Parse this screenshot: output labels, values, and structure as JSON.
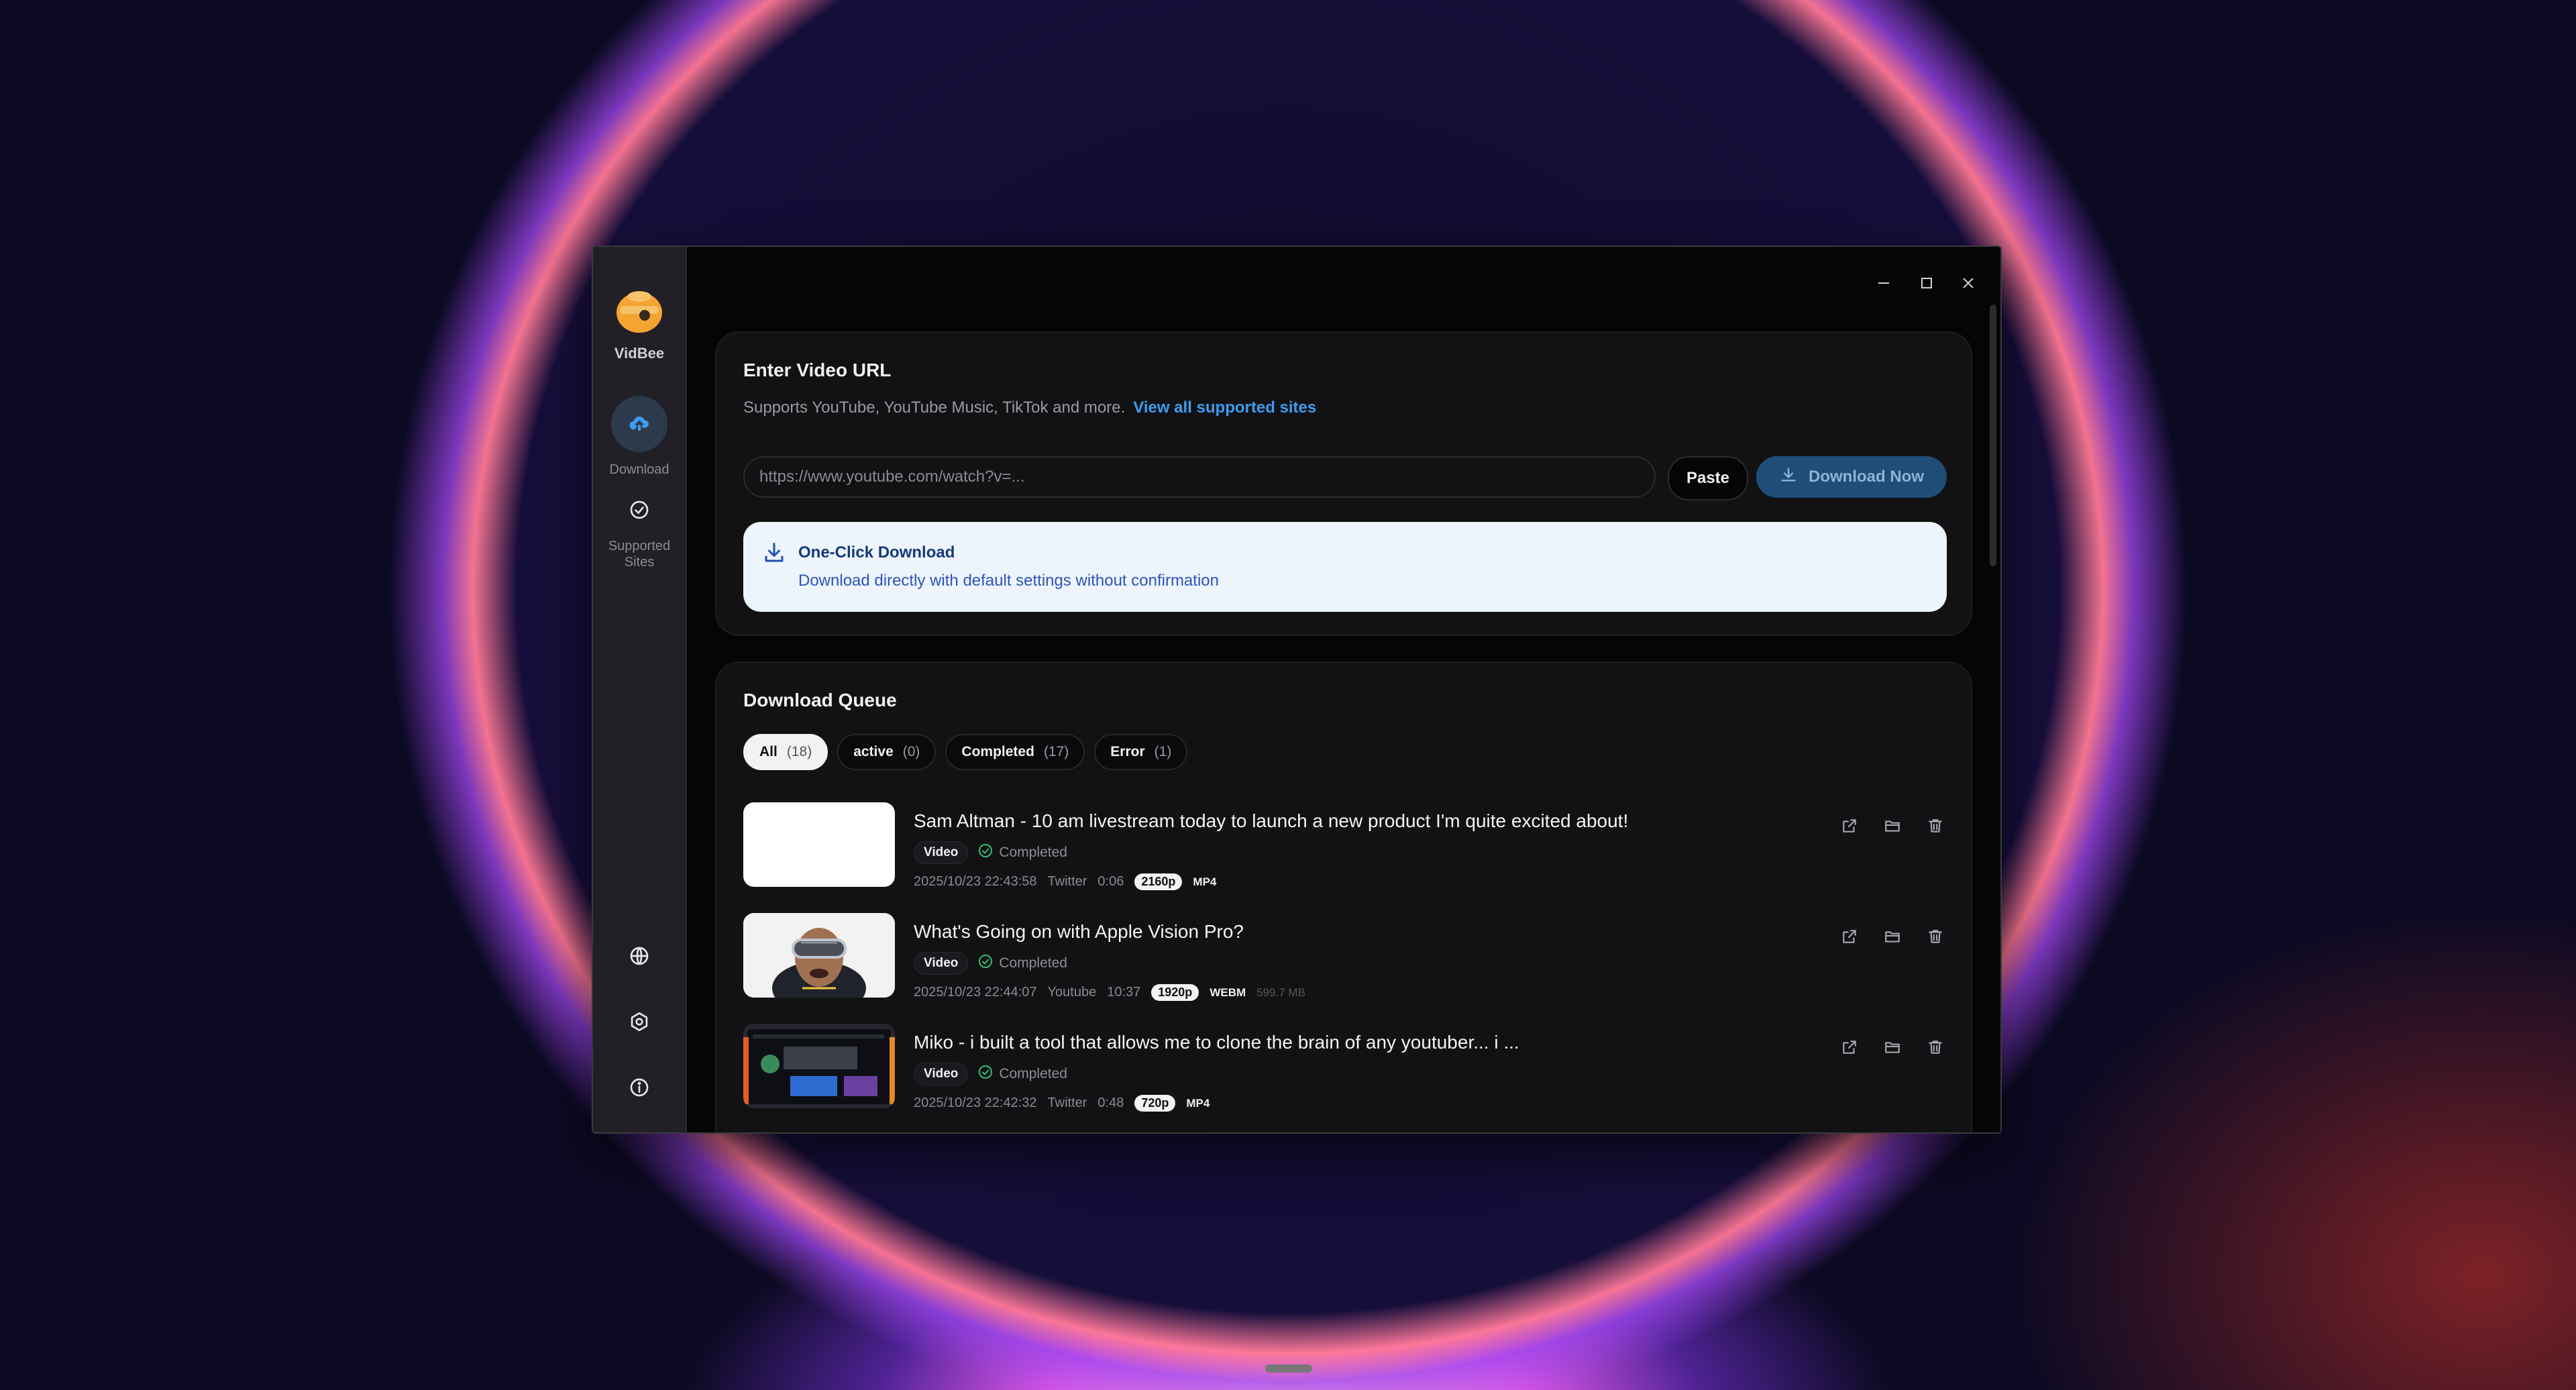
{
  "app": {
    "name": "VidBee",
    "accent_color": "#3d9df0",
    "brand_color": "#f3a431"
  },
  "sidebar": {
    "items": [
      {
        "label": "Download",
        "icon": "cloud-download-icon",
        "active": true
      },
      {
        "label": "Supported Sites",
        "icon": "check-circle-icon",
        "active": false
      }
    ],
    "bottom_icons": [
      "globe-icon",
      "settings-icon",
      "info-icon"
    ]
  },
  "window_controls": [
    "minimize-icon",
    "maximize-icon",
    "close-icon"
  ],
  "url_section": {
    "title": "Enter Video URL",
    "subtitle": "Supports YouTube, YouTube Music, TikTok and more.",
    "link": "View all supported sites",
    "input_placeholder": "https://www.youtube.com/watch?v=...",
    "paste_label": "Paste",
    "download_label": "Download Now",
    "one_click": {
      "title": "One-Click Download",
      "description": "Download directly with default settings without confirmation"
    }
  },
  "queue": {
    "title": "Download Queue",
    "filters": [
      {
        "label": "All",
        "count": "(18)",
        "active": true
      },
      {
        "label": "active",
        "count": "(0)",
        "active": false
      },
      {
        "label": "Completed",
        "count": "(17)",
        "active": false
      },
      {
        "label": "Error",
        "count": "(1)",
        "active": false
      }
    ],
    "items": [
      {
        "title": "Sam Altman - 10 am livestream today to launch a new product I'm quite excited about!",
        "type": "Video",
        "status": "Completed",
        "datetime": "2025/10/23 22:43:58",
        "source": "Twitter",
        "duration": "0:06",
        "resolution": "2160p",
        "format": "MP4",
        "size": ""
      },
      {
        "title": "What's Going on with Apple Vision Pro?",
        "type": "Video",
        "status": "Completed",
        "datetime": "2025/10/23 22:44:07",
        "source": "Youtube",
        "duration": "10:37",
        "resolution": "1920p",
        "format": "WEBM",
        "size": "599.7 MB"
      },
      {
        "title": "Miko - i built a tool that allows me to clone the brain of any youtuber... i ...",
        "type": "Video",
        "status": "Completed",
        "datetime": "2025/10/23 22:42:32",
        "source": "Twitter",
        "duration": "0:48",
        "resolution": "720p",
        "format": "MP4",
        "size": ""
      }
    ]
  }
}
